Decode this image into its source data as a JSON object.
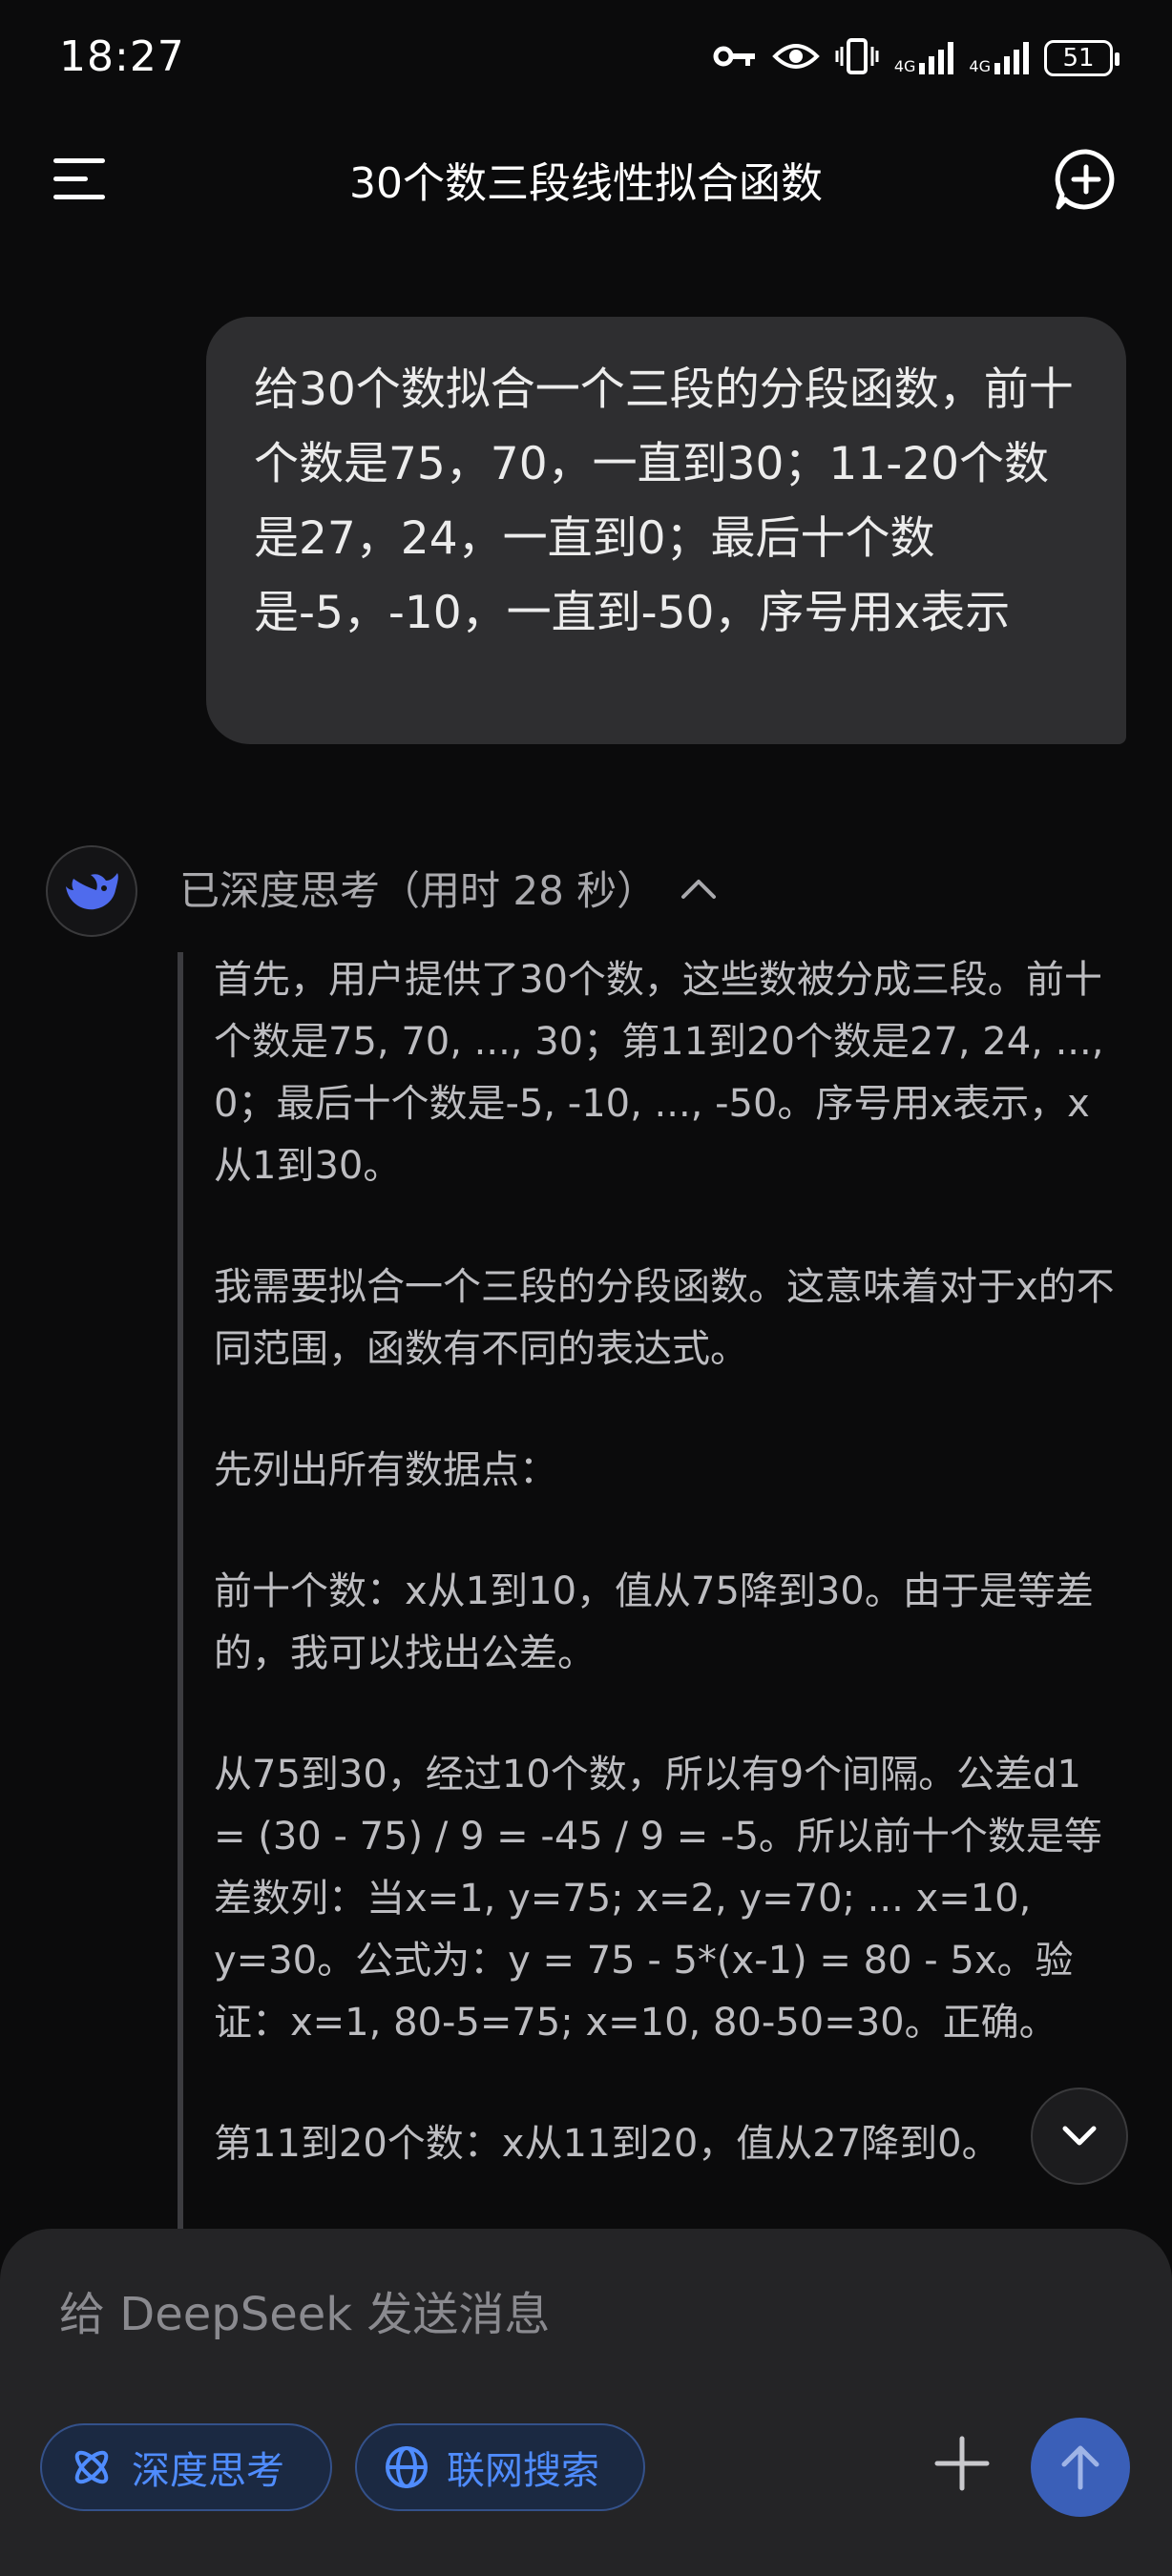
{
  "status_bar": {
    "time": "18:27",
    "network_1": "4G",
    "network_2": "4G",
    "battery": "51"
  },
  "header": {
    "title": "30个数三段线性拟合函数"
  },
  "user_message": {
    "text": "给30个数拟合一个三段的分段函数，前十个数是75，70，一直到30；11-20个数是27，24，一直到0；最后十个数是-5，-10，一直到-50，序号用x表示"
  },
  "assistant": {
    "thinking_status": "已深度思考（用时 28 秒）",
    "thinking_paragraphs": [
      "首先，用户提供了30个数，这些数被分成三段。前十个数是75, 70, ..., 30；第11到20个数是27, 24, ..., 0；最后十个数是-5, -10, ..., -50。序号用x表示，x从1到30。",
      "我需要拟合一个三段的分段函数。这意味着对于x的不同范围，函数有不同的表达式。",
      "先列出所有数据点：",
      "前十个数：x从1到10，值从75降到30。由于是等差的，我可以找出公差。",
      "从75到30，经过10个数，所以有9个间隔。公差d1 = (30 - 75) / 9 = -45 / 9 = -5。所以前十个数是等差数列：当x=1, y=75; x=2, y=70; ... x=10, y=30。公式为：y = 75 - 5*(x-1) = 80 - 5x。验证：x=1, 80-5=75; x=10, 80-50=30。正确。",
      "第11到20个数：x从11到20，值从27降到0。"
    ]
  },
  "composer": {
    "placeholder": "给 DeepSeek 发送消息",
    "deep_think_label": "深度思考",
    "web_search_label": "联网搜索"
  },
  "colors": {
    "background": "#0b0b0c",
    "bubble": "#2e2e30",
    "accent": "#4f8cff",
    "send_button": "#3a5fb8"
  }
}
